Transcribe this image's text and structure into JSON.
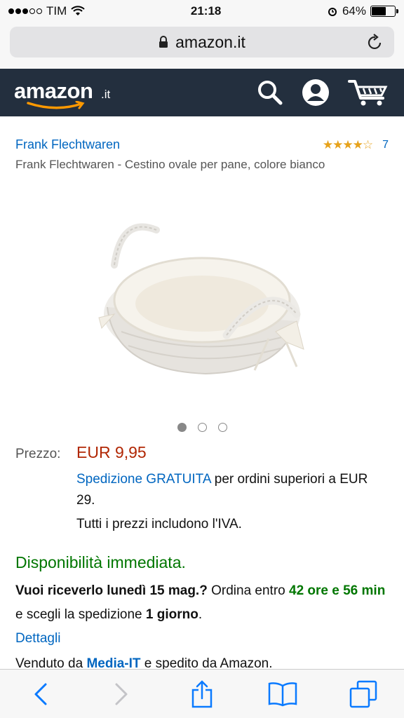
{
  "status": {
    "carrier": "TIM",
    "time": "21:18",
    "battery": "64%",
    "battery_level": 0.64,
    "signal_bars_filled": 3,
    "signal_bars_total": 5
  },
  "browser": {
    "url": "amazon.it"
  },
  "header": {
    "logo_text": "amazon",
    "logo_tld": ".it",
    "icons": [
      "search-icon",
      "account-icon",
      "cart-icon"
    ]
  },
  "product": {
    "brand": "Frank Flechtwaren",
    "rating_stars": "★★★★☆",
    "rating_value": 3.5,
    "review_count": "7",
    "title": "Frank Flechtwaren - Cestino ovale per pane, colore bianco",
    "image_count": 3,
    "active_image": 1
  },
  "pricing": {
    "label": "Prezzo:",
    "price": "EUR 9,95",
    "shipping_link": "Spedizione GRATUITA",
    "shipping_rest": " per ordini superiori a EUR 29.",
    "vat_note": "Tutti i prezzi includono l'IVA."
  },
  "availability": {
    "status": "Disponibilità immediata.",
    "delivery_question": "Vuoi riceverlo lunedì 15 mag.?",
    "order_within": " Ordina entro ",
    "countdown": "42 ore e 56 min",
    "choose_shipping": " e scegli la spedizione ",
    "shipping_speed": "1 giorno",
    "period": ".",
    "details_link": "Dettagli"
  },
  "seller": {
    "prefix": "Venduto da ",
    "name": "Media-IT",
    "suffix": " e spedito da Amazon."
  },
  "toolbar": {
    "icons": [
      "back-icon",
      "forward-icon",
      "share-icon",
      "bookmarks-icon",
      "tabs-icon"
    ]
  },
  "colors": {
    "header_bg": "#232f3e",
    "link": "#0066c0",
    "price": "#b12704",
    "in_stock": "#007600",
    "star": "#e7a21a",
    "smile": "#ff9900",
    "ios_blue": "#0a7aff"
  }
}
